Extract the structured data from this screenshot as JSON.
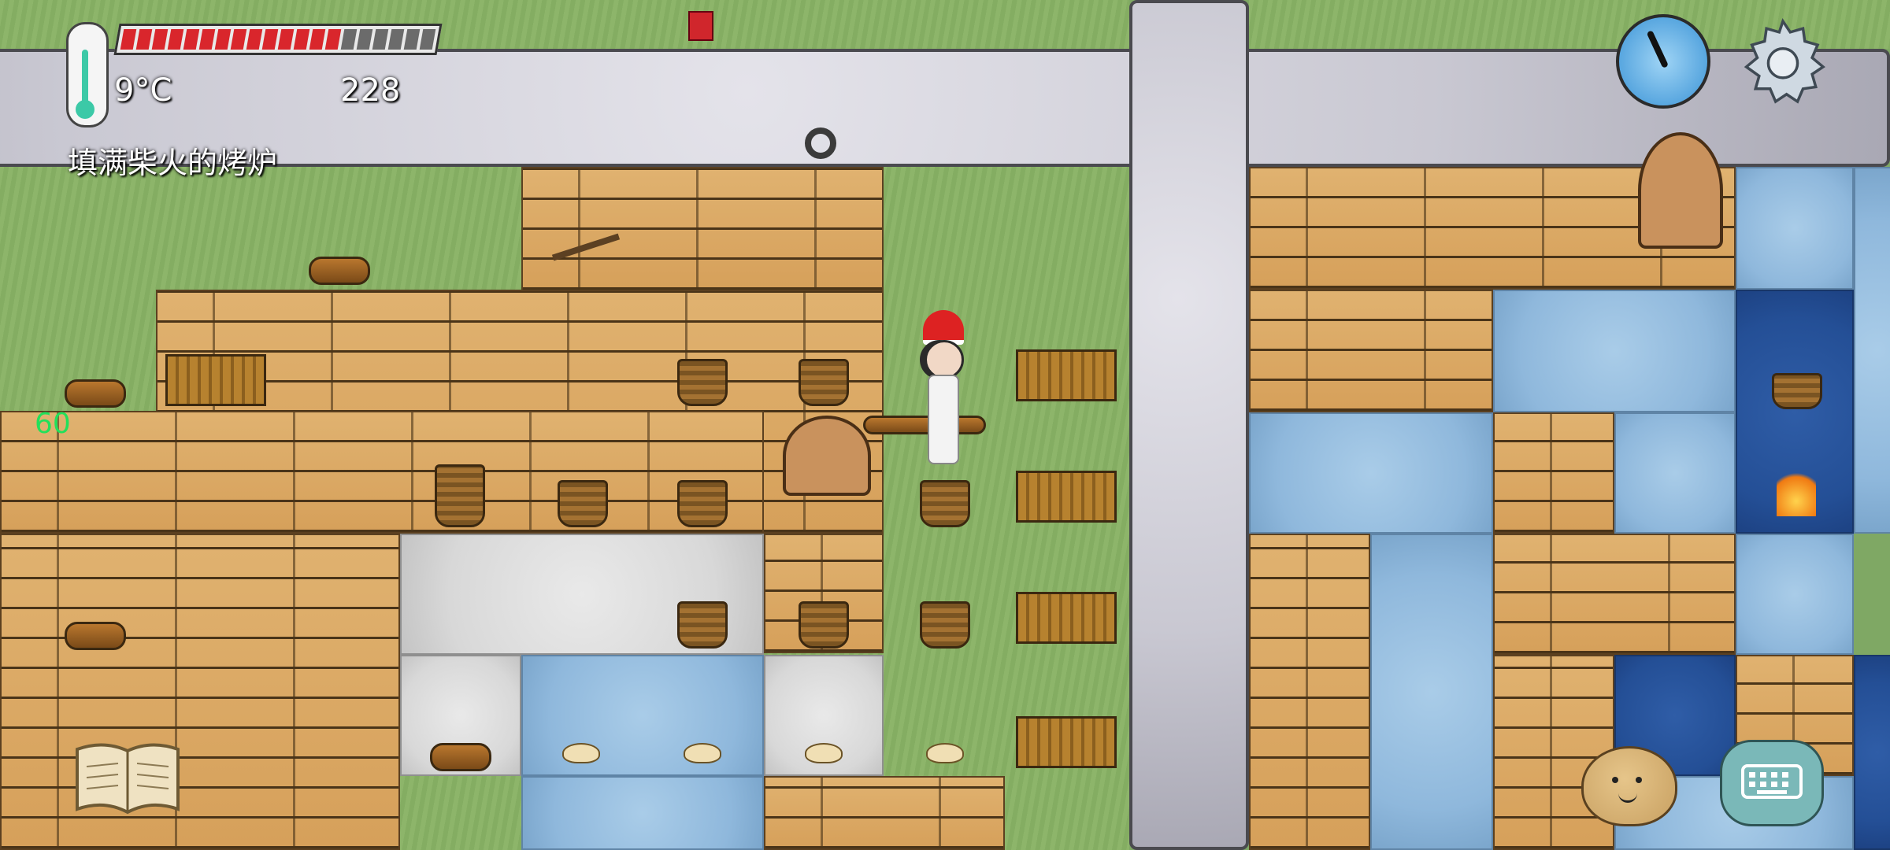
{
  "hud": {
    "temperature": "9°C",
    "score": "228",
    "held_item_hint": "填满柴火的烤炉",
    "fps": "60",
    "health": {
      "total_segments": 20,
      "filled_segments": 14,
      "fill_color": "#d9262c",
      "empty_color": "#6b6b6b"
    }
  },
  "icons": {
    "thermometer": "thermometer-icon",
    "compass": "compass-icon",
    "settings": "gear-icon",
    "recipe_book": "open-book-icon",
    "emote": "potato-face-icon",
    "keyboard": "keyboard-chat-icon"
  },
  "colors": {
    "grass": "#8db56a",
    "stone": "#c9c8d2",
    "wood": "#d6a05a",
    "ice": "#8fb8dc",
    "deep_water": "#244f96",
    "snow": "#d8d8d8"
  }
}
